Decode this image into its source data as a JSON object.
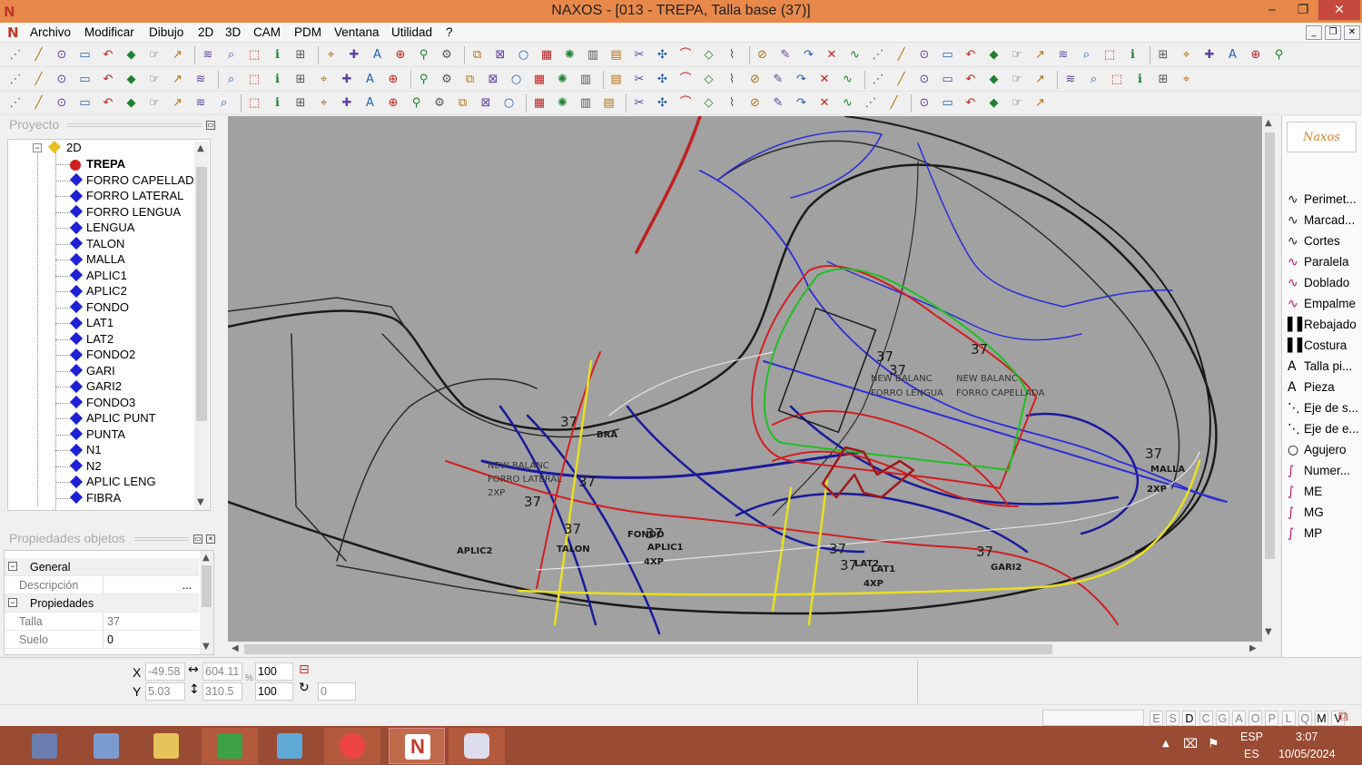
{
  "window": {
    "title": "NAXOS - [013 - TREPA, Talla base (37)]",
    "minimize": "‒",
    "restore": "❐",
    "close": "✕"
  },
  "menu": [
    "Archivo",
    "Modificar",
    "Dibujo",
    "2D",
    "3D",
    "CAM",
    "PDM",
    "Ventana",
    "Utilidad",
    "?"
  ],
  "mdi_buttons": [
    "_",
    "❐",
    "✕"
  ],
  "project_panel": {
    "title": "Proyecto",
    "root": "2D",
    "items": [
      "TREPA",
      "FORRO CAPELLADA",
      "FORRO LATERAL",
      "FORRO LENGUA",
      "LENGUA",
      "TALON",
      "MALLA",
      "APLIC1",
      "APLIC2",
      "FONDO",
      "LAT1",
      "LAT2",
      "FONDO2",
      "GARI",
      "GARI2",
      "FONDO3",
      "APLIC PUNT",
      "PUNTA",
      "N1",
      "N2",
      "APLIC LENG",
      "FIBRA"
    ],
    "selected_color": "#d02020",
    "item_color": "#1f1fd6"
  },
  "properties_panel": {
    "title": "Propiedades objetos",
    "general": "General",
    "descripcion_label": "Descripción",
    "descripcion_btn": "...",
    "propiedades": "Propiedades",
    "talla_label": "Talla",
    "talla_value": "37",
    "suelo_label": "Suelo",
    "suelo_value": "0"
  },
  "right_panel": {
    "logo": "Naxos",
    "items": [
      {
        "icon": "∿",
        "label": "Perimet..."
      },
      {
        "icon": "∿",
        "label": "Marcad..."
      },
      {
        "icon": "∿",
        "label": "Cortes"
      },
      {
        "icon": "∿",
        "label": "Paralela"
      },
      {
        "icon": "∿",
        "label": "Doblado"
      },
      {
        "icon": "∿",
        "label": "Empalme"
      },
      {
        "icon": "▌▌",
        "label": "Rebajado"
      },
      {
        "icon": "▌▌",
        "label": "Costura"
      },
      {
        "icon": "A",
        "label": "Talla pi..."
      },
      {
        "icon": "A",
        "label": "Pieza"
      },
      {
        "icon": "⋱",
        "label": "Eje de s..."
      },
      {
        "icon": "⋱",
        "label": "Eje de e..."
      },
      {
        "icon": "○",
        "label": "Agujero"
      },
      {
        "icon": "∫",
        "label": "Numer..."
      },
      {
        "icon": "∫",
        "label": "ME"
      },
      {
        "icon": "∫",
        "label": "MG"
      },
      {
        "icon": "∫",
        "label": "MP"
      }
    ]
  },
  "drawing_labels": {
    "sizes": "37",
    "l1": "NEW BALANC",
    "l2": "FORRO LATERAL",
    "l3": "2XP",
    "l4": "NEW BALANC",
    "l5": "FORRO LENGUA",
    "l6": "NEW BALANC",
    "l7": "FORRO CAPELLADA",
    "l8": "APLIC2",
    "l9": "TALON",
    "l10": "FONDO",
    "l11": "APLIC1",
    "l12": "4XP",
    "l13": "LAT2",
    "l14": "LAT1",
    "l15": "GARI2",
    "l16": "MALLA",
    "l17": "2XP",
    "l18": "4XP",
    "l19": "BRA"
  },
  "status": {
    "x_label": "X",
    "y_label": "Y",
    "x_value": "-49.58",
    "y_value": "5.03",
    "w_value": "604.11",
    "h_value": "310.5",
    "scale_x": "100",
    "scale_y": "100",
    "rotation": "0",
    "percent": "%"
  },
  "keys": [
    "E",
    "S",
    "D",
    "C",
    "G",
    "A",
    "O",
    "P",
    "L",
    "Q",
    "M",
    "V"
  ],
  "tray": {
    "lang1": "ESP",
    "lang2": "ES",
    "time": "3:07",
    "date": "10/05/2024"
  }
}
